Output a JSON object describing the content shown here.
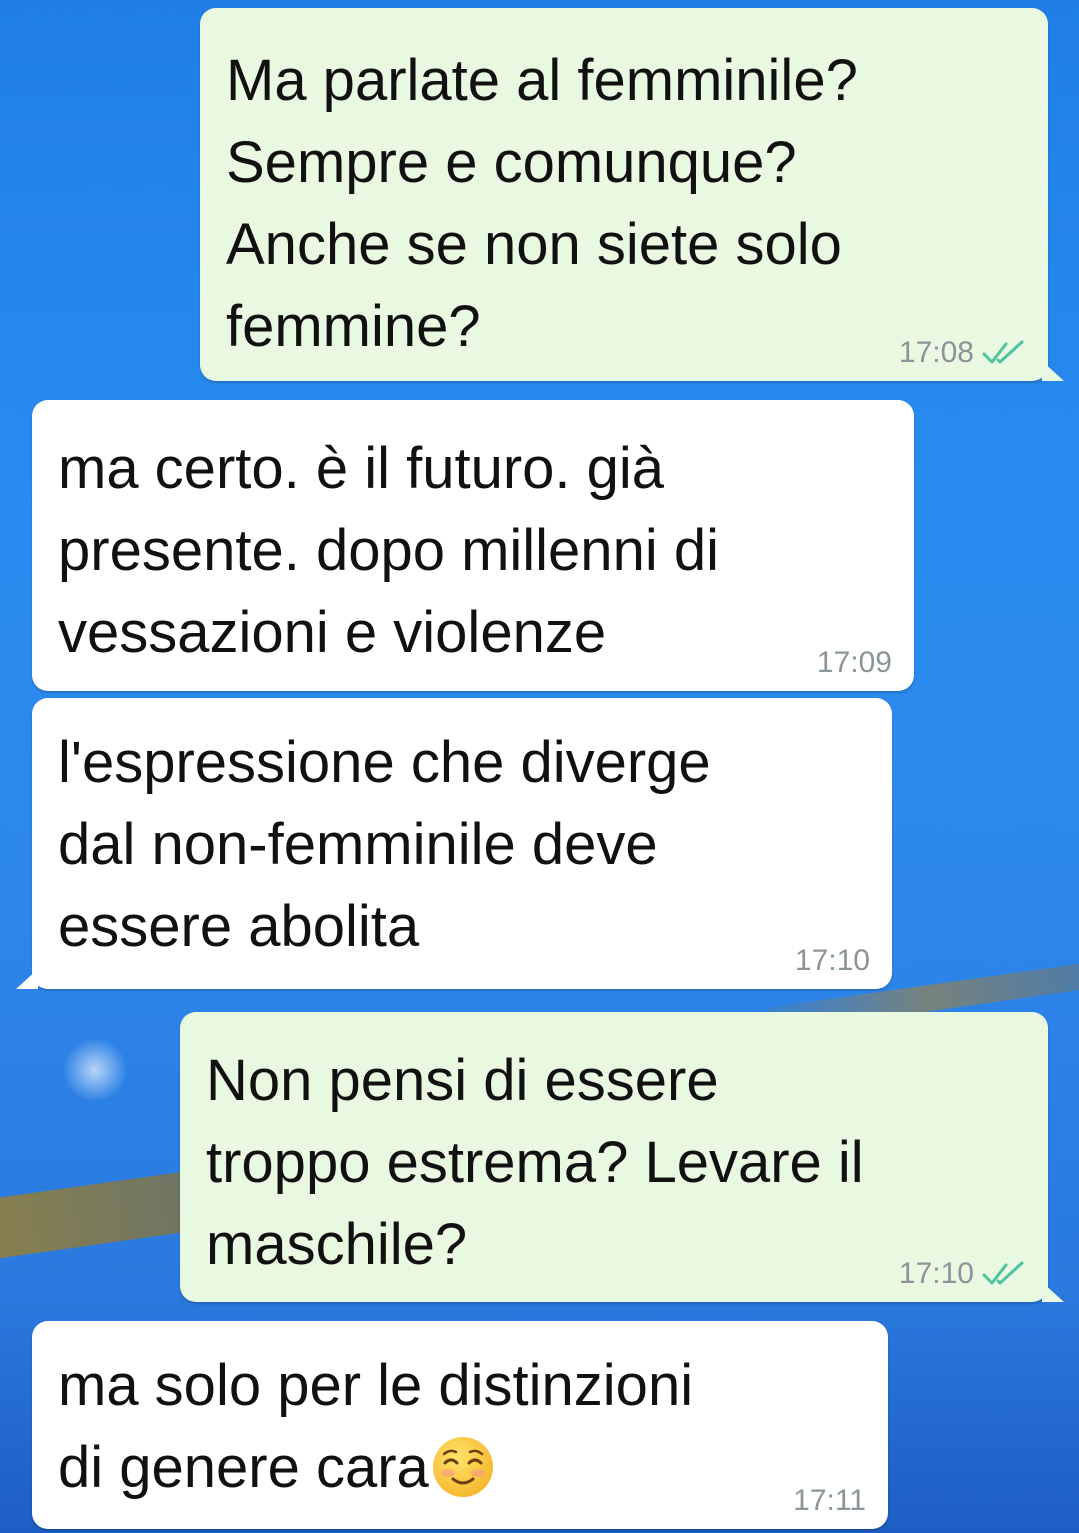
{
  "background": {
    "color": "#2a8cf0"
  },
  "colors": {
    "outgoing_bubble": "#e9f8e0",
    "incoming_bubble": "#ffffff",
    "timestamp": "#8a9599",
    "read_checks": "#4fc3a1"
  },
  "messages": [
    {
      "direction": "outgoing",
      "text": "Ma parlate al femminile?\nSempre e comunque?\nAnche se non siete solo\nfemmine?",
      "time": "17:08",
      "status_icon": "double-check-icon"
    },
    {
      "direction": "incoming",
      "text": "ma certo. è il futuro. già\npresente. dopo millenni di\nvessazioni e violenze",
      "time": "17:09"
    },
    {
      "direction": "incoming",
      "text": "l'espressione che diverge\ndal non-femminile deve\nessere abolita",
      "time": "17:10"
    },
    {
      "direction": "outgoing",
      "text": "Non pensi di essere\ntroppo estrema? Levare il\nmaschile?",
      "time": "17:10",
      "status_icon": "double-check-icon"
    },
    {
      "direction": "incoming",
      "text_line1": "ma solo per le distinzioni",
      "text_line2": "di genere cara",
      "emoji": "smiling-face-icon",
      "time": "17:11"
    }
  ]
}
